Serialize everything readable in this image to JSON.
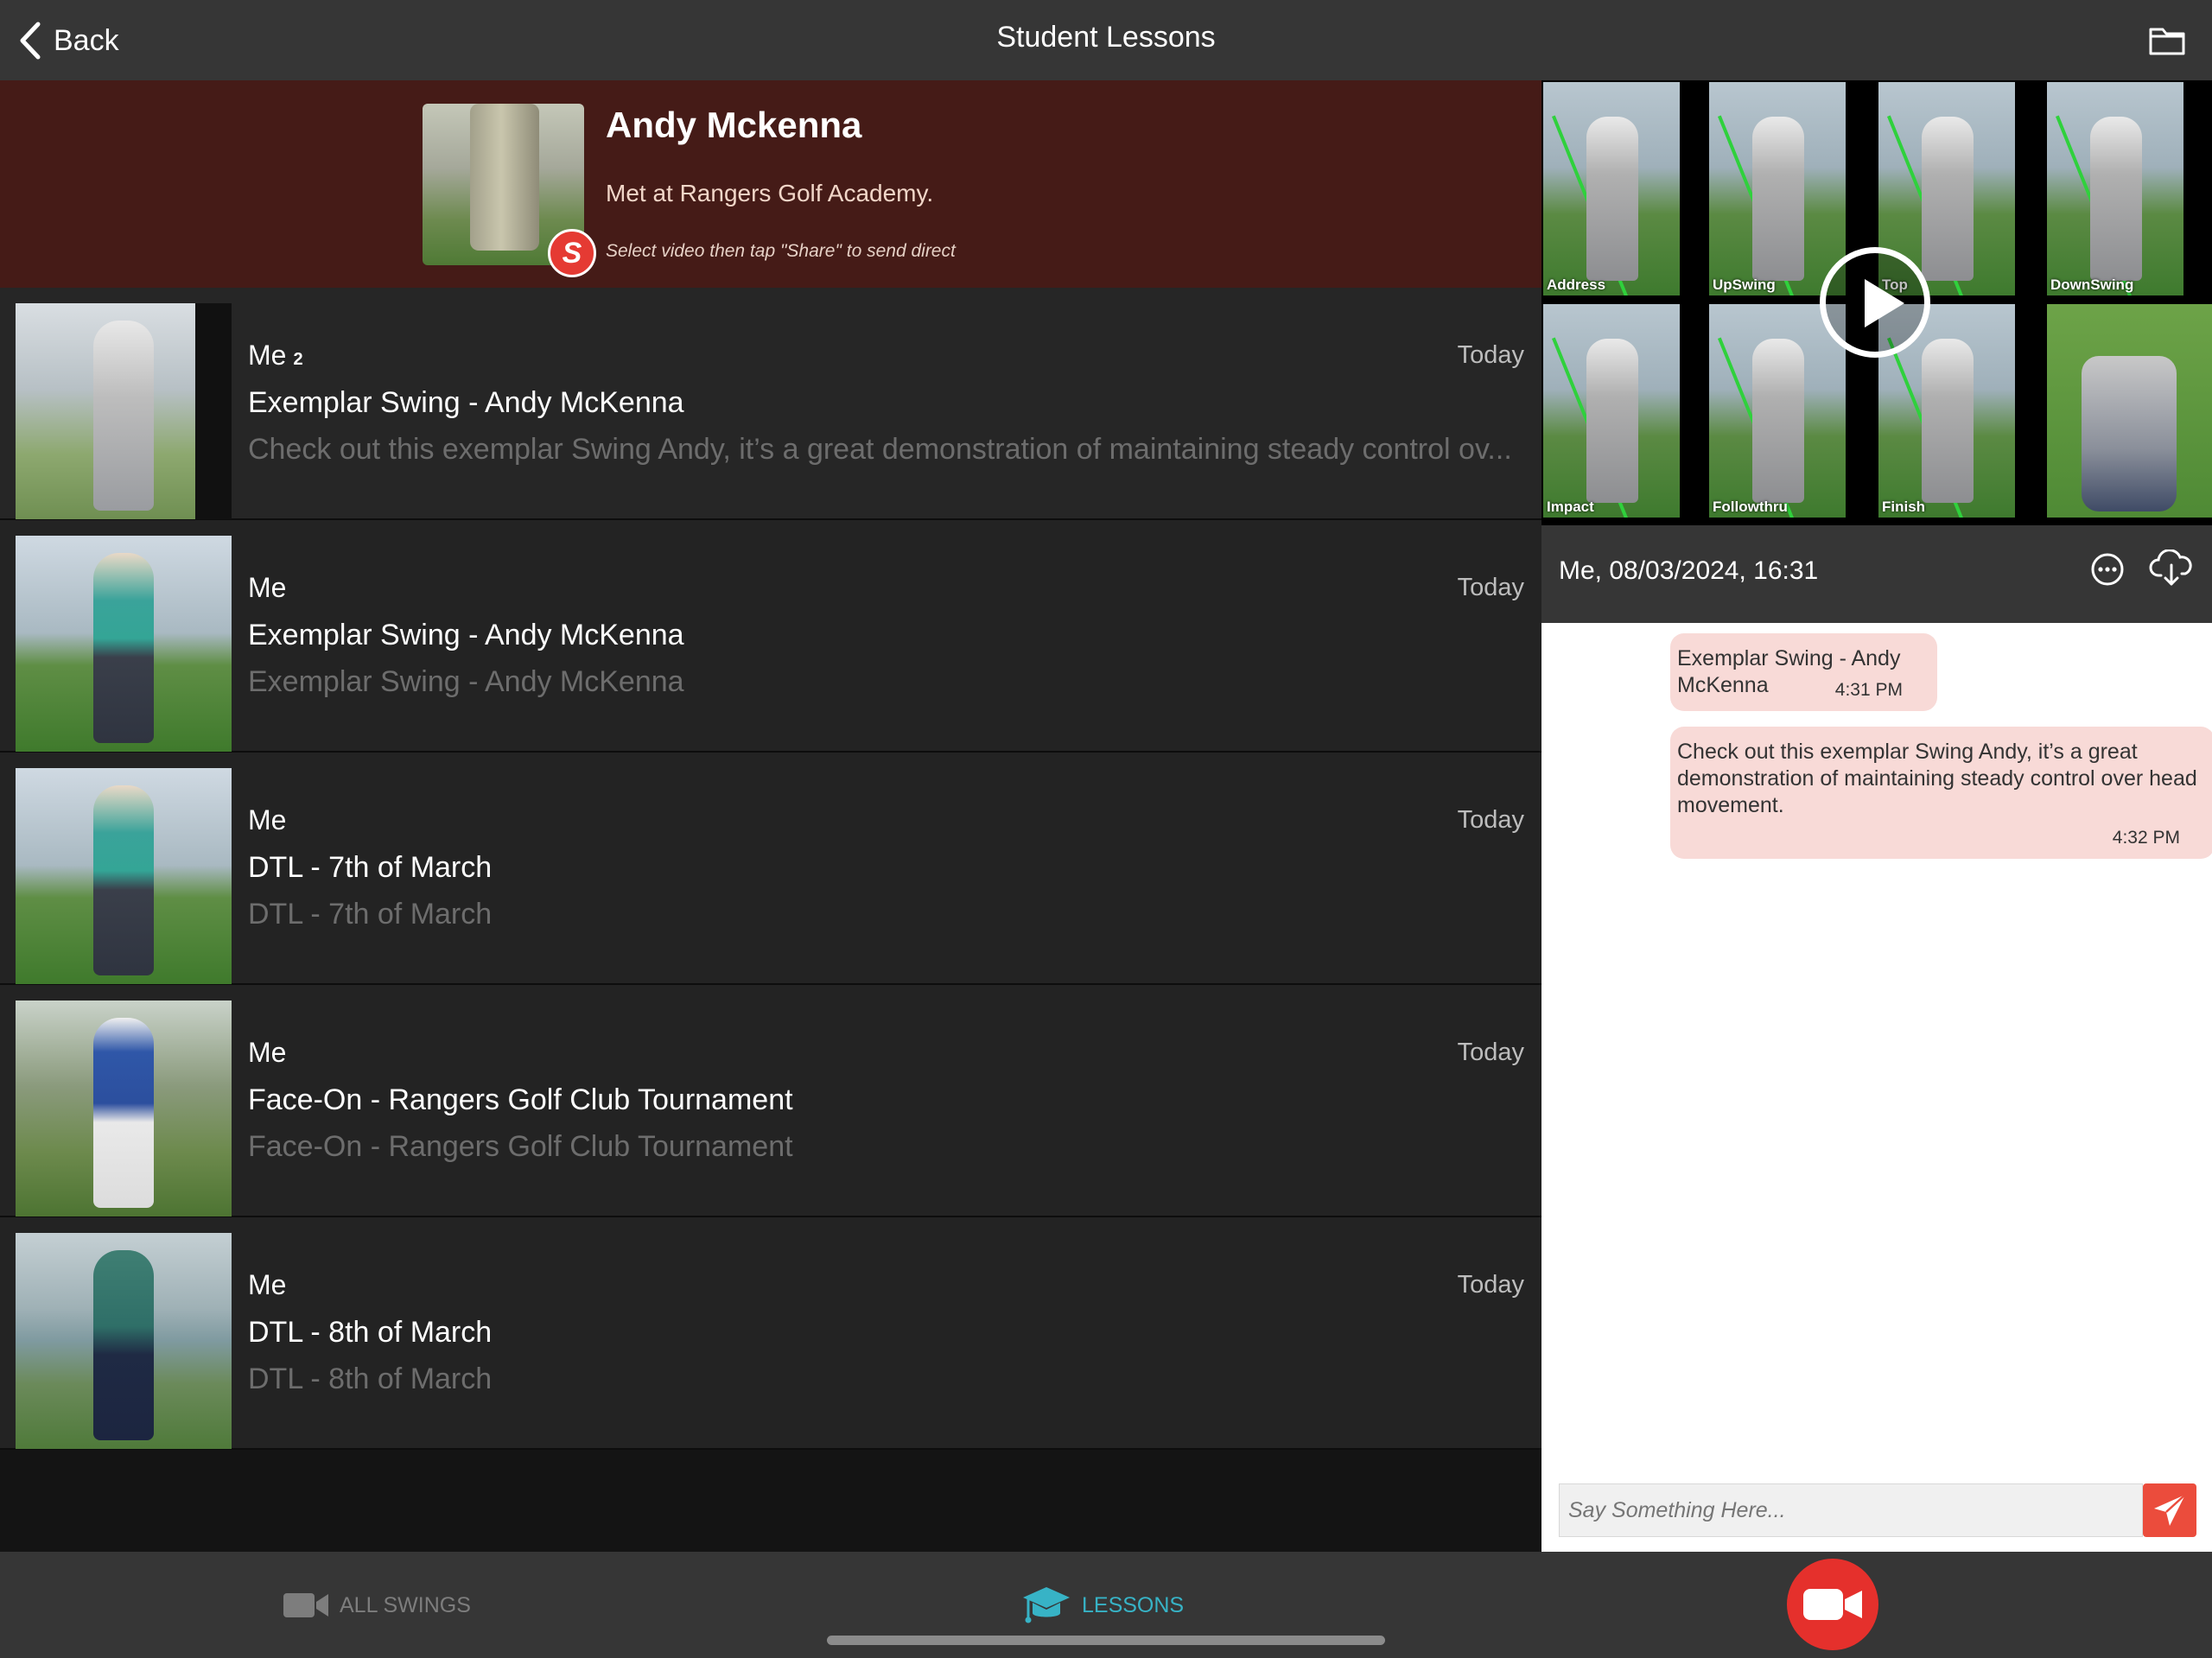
{
  "nav": {
    "back_label": "Back",
    "title": "Student Lessons",
    "folder_icon": "folder-icon"
  },
  "student": {
    "name": "Andy Mckenna",
    "note": "Met at Rangers Golf Academy.",
    "hint": "Select video then tap \"Share\" to send direct",
    "badge_letter": "S",
    "badge_color": "#e53a33"
  },
  "lessons": [
    {
      "author": "Me",
      "count": "2",
      "date": "Today",
      "title": "Exemplar Swing - Andy McKenna",
      "description": "Check out this exemplar Swing Andy, it’s a great demonstration of maintaining steady control ov..."
    },
    {
      "author": "Me",
      "date": "Today",
      "title": "Exemplar Swing - Andy McKenna",
      "description": "Exemplar Swing - Andy McKenna"
    },
    {
      "author": "Me",
      "date": "Today",
      "title": "DTL - 7th of March",
      "description": "DTL - 7th of March"
    },
    {
      "author": "Me",
      "date": "Today",
      "title": "Face-On - Rangers Golf Club Tournament",
      "description": "Face-On - Rangers Golf Club Tournament"
    },
    {
      "author": "Me",
      "date": "Today",
      "title": "DTL - 8th of March",
      "description": "DTL - 8th of March"
    }
  ],
  "video": {
    "frames": [
      "Address",
      "UpSwing",
      "Top",
      "DownSwing",
      "Impact",
      "Followthru",
      "Finish"
    ],
    "info_date": "Me, 08/03/2024, 16:31"
  },
  "chat": {
    "messages": [
      {
        "text": "Exemplar Swing - Andy McKenna",
        "time": "4:31 PM"
      },
      {
        "text": "Check out this exemplar Swing Andy, it’s a great demonstration of maintaining steady control over head movement.",
        "time": "4:32 PM"
      }
    ],
    "input_placeholder": "Say Something Here..."
  },
  "tabs": {
    "all_swings": "ALL SWINGS",
    "lessons": "LESSONS",
    "active_color": "#37b3c6",
    "record_color": "#e5302c"
  }
}
